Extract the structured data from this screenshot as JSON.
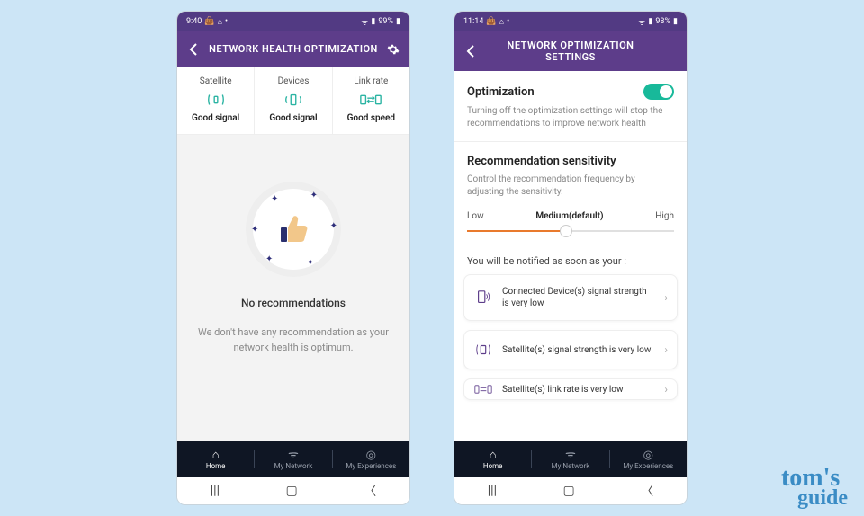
{
  "watermark": {
    "line1": "tom's",
    "line2": "guide"
  },
  "phone1": {
    "status": {
      "time": "9:40",
      "battery": "99%"
    },
    "header": {
      "title": "NETWORK HEALTH OPTIMIZATION"
    },
    "cards": [
      {
        "label": "Satellite",
        "status": "Good signal"
      },
      {
        "label": "Devices",
        "status": "Good signal"
      },
      {
        "label": "Link rate",
        "status": "Good speed"
      }
    ],
    "norec_title": "No recommendations",
    "norec_desc": "We don't have any recommendation as your network health is optimum."
  },
  "phone2": {
    "status": {
      "time": "11:14",
      "battery": "98%"
    },
    "header": {
      "title_line1": "NETWORK OPTIMIZATION",
      "title_line2": "SETTINGS"
    },
    "opt": {
      "title": "Optimization",
      "desc": "Turning off the optimization settings will stop the recommendations to improve network health",
      "on": true
    },
    "sens": {
      "title": "Recommendation sensitivity",
      "desc": "Control the recommendation frequency by adjusting the sensitivity.",
      "low": "Low",
      "med": "Medium(default)",
      "high": "High"
    },
    "notify_lead": "You will be notified as soon as your :",
    "cards": [
      {
        "text": "Connected Device(s) signal strength is very low"
      },
      {
        "text": "Satellite(s) signal strength is very low"
      },
      {
        "text": "Satellite(s) link rate is very low"
      }
    ]
  },
  "bottomnav": {
    "home": "Home",
    "mynetwork": "My Network",
    "myexp": "My Experiences"
  }
}
